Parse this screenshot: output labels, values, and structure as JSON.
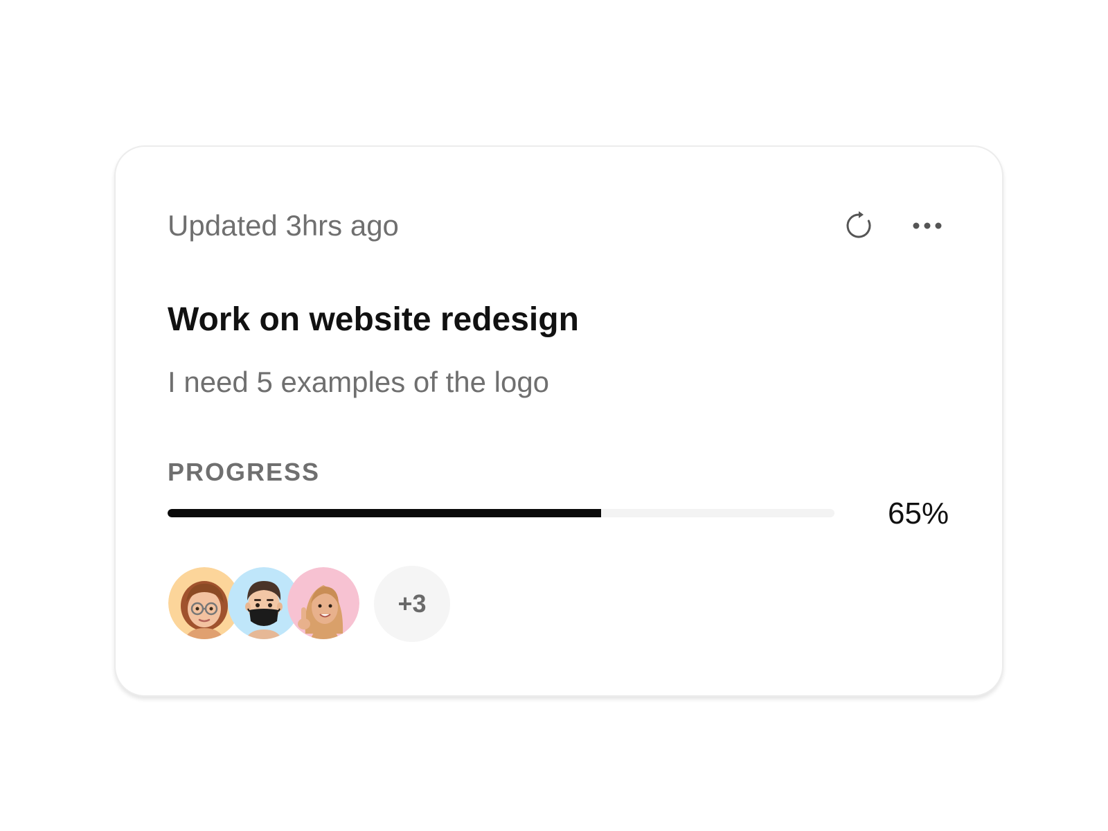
{
  "card": {
    "updated_text": "Updated 3hrs ago",
    "title": "Work on website redesign",
    "description": "I need 5 examples of the logo",
    "progress": {
      "label": "PROGRESS",
      "value_text": "65%",
      "fraction": 0.65
    },
    "icons": {
      "refresh": "refresh-icon",
      "more": "more-horizontal-icon"
    },
    "members": {
      "avatars": [
        {
          "name": "avatar-woman-glasses",
          "background": "#fcd59a"
        },
        {
          "name": "avatar-man-mask",
          "background": "#bfe6fa"
        },
        {
          "name": "avatar-woman-blonde",
          "background": "#f7c2d2"
        }
      ],
      "more_count": "+3"
    }
  },
  "colors": {
    "progress_fill": "#0a0a0a",
    "progress_track": "#f3f3f3",
    "muted_text": "#6f6f6f",
    "title_text": "#111111"
  }
}
